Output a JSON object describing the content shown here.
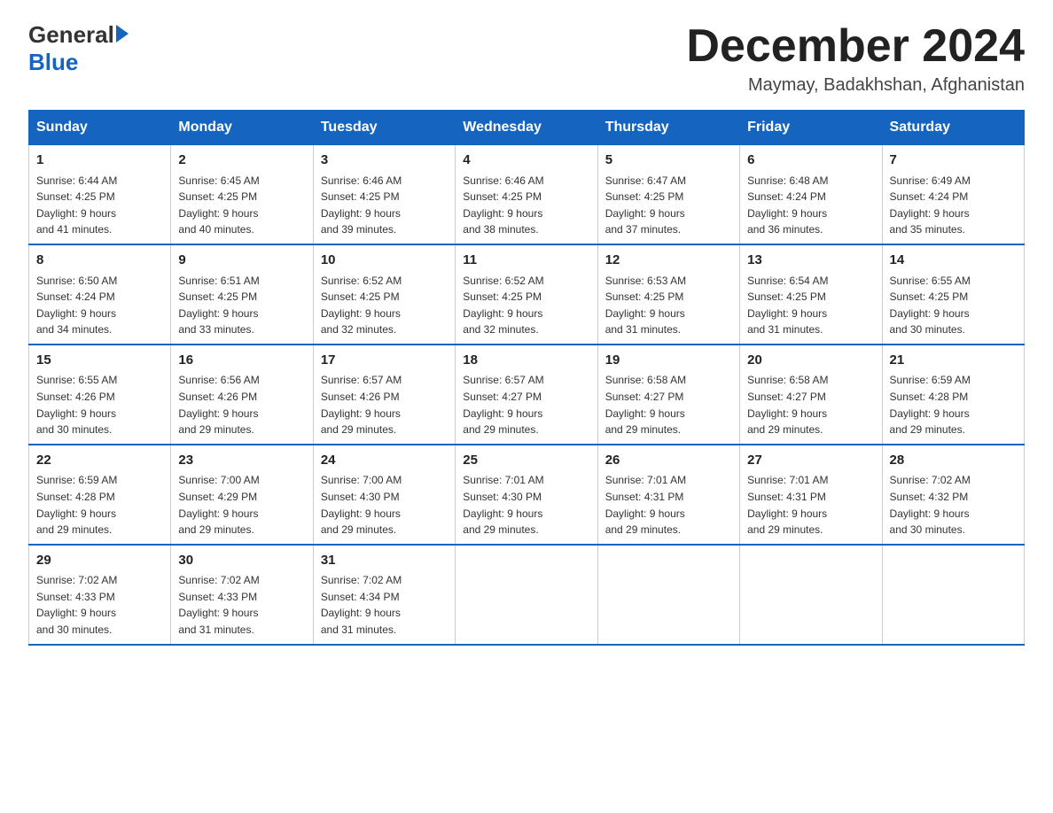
{
  "header": {
    "logo_general": "General",
    "logo_blue": "Blue",
    "month_title": "December 2024",
    "location": "Maymay, Badakhshan, Afghanistan"
  },
  "days_of_week": [
    "Sunday",
    "Monday",
    "Tuesday",
    "Wednesday",
    "Thursday",
    "Friday",
    "Saturday"
  ],
  "weeks": [
    [
      {
        "day": "1",
        "sunrise": "6:44 AM",
        "sunset": "4:25 PM",
        "daylight": "9 hours and 41 minutes."
      },
      {
        "day": "2",
        "sunrise": "6:45 AM",
        "sunset": "4:25 PM",
        "daylight": "9 hours and 40 minutes."
      },
      {
        "day": "3",
        "sunrise": "6:46 AM",
        "sunset": "4:25 PM",
        "daylight": "9 hours and 39 minutes."
      },
      {
        "day": "4",
        "sunrise": "6:46 AM",
        "sunset": "4:25 PM",
        "daylight": "9 hours and 38 minutes."
      },
      {
        "day": "5",
        "sunrise": "6:47 AM",
        "sunset": "4:25 PM",
        "daylight": "9 hours and 37 minutes."
      },
      {
        "day": "6",
        "sunrise": "6:48 AM",
        "sunset": "4:24 PM",
        "daylight": "9 hours and 36 minutes."
      },
      {
        "day": "7",
        "sunrise": "6:49 AM",
        "sunset": "4:24 PM",
        "daylight": "9 hours and 35 minutes."
      }
    ],
    [
      {
        "day": "8",
        "sunrise": "6:50 AM",
        "sunset": "4:24 PM",
        "daylight": "9 hours and 34 minutes."
      },
      {
        "day": "9",
        "sunrise": "6:51 AM",
        "sunset": "4:25 PM",
        "daylight": "9 hours and 33 minutes."
      },
      {
        "day": "10",
        "sunrise": "6:52 AM",
        "sunset": "4:25 PM",
        "daylight": "9 hours and 32 minutes."
      },
      {
        "day": "11",
        "sunrise": "6:52 AM",
        "sunset": "4:25 PM",
        "daylight": "9 hours and 32 minutes."
      },
      {
        "day": "12",
        "sunrise": "6:53 AM",
        "sunset": "4:25 PM",
        "daylight": "9 hours and 31 minutes."
      },
      {
        "day": "13",
        "sunrise": "6:54 AM",
        "sunset": "4:25 PM",
        "daylight": "9 hours and 31 minutes."
      },
      {
        "day": "14",
        "sunrise": "6:55 AM",
        "sunset": "4:25 PM",
        "daylight": "9 hours and 30 minutes."
      }
    ],
    [
      {
        "day": "15",
        "sunrise": "6:55 AM",
        "sunset": "4:26 PM",
        "daylight": "9 hours and 30 minutes."
      },
      {
        "day": "16",
        "sunrise": "6:56 AM",
        "sunset": "4:26 PM",
        "daylight": "9 hours and 29 minutes."
      },
      {
        "day": "17",
        "sunrise": "6:57 AM",
        "sunset": "4:26 PM",
        "daylight": "9 hours and 29 minutes."
      },
      {
        "day": "18",
        "sunrise": "6:57 AM",
        "sunset": "4:27 PM",
        "daylight": "9 hours and 29 minutes."
      },
      {
        "day": "19",
        "sunrise": "6:58 AM",
        "sunset": "4:27 PM",
        "daylight": "9 hours and 29 minutes."
      },
      {
        "day": "20",
        "sunrise": "6:58 AM",
        "sunset": "4:27 PM",
        "daylight": "9 hours and 29 minutes."
      },
      {
        "day": "21",
        "sunrise": "6:59 AM",
        "sunset": "4:28 PM",
        "daylight": "9 hours and 29 minutes."
      }
    ],
    [
      {
        "day": "22",
        "sunrise": "6:59 AM",
        "sunset": "4:28 PM",
        "daylight": "9 hours and 29 minutes."
      },
      {
        "day": "23",
        "sunrise": "7:00 AM",
        "sunset": "4:29 PM",
        "daylight": "9 hours and 29 minutes."
      },
      {
        "day": "24",
        "sunrise": "7:00 AM",
        "sunset": "4:30 PM",
        "daylight": "9 hours and 29 minutes."
      },
      {
        "day": "25",
        "sunrise": "7:01 AM",
        "sunset": "4:30 PM",
        "daylight": "9 hours and 29 minutes."
      },
      {
        "day": "26",
        "sunrise": "7:01 AM",
        "sunset": "4:31 PM",
        "daylight": "9 hours and 29 minutes."
      },
      {
        "day": "27",
        "sunrise": "7:01 AM",
        "sunset": "4:31 PM",
        "daylight": "9 hours and 29 minutes."
      },
      {
        "day": "28",
        "sunrise": "7:02 AM",
        "sunset": "4:32 PM",
        "daylight": "9 hours and 30 minutes."
      }
    ],
    [
      {
        "day": "29",
        "sunrise": "7:02 AM",
        "sunset": "4:33 PM",
        "daylight": "9 hours and 30 minutes."
      },
      {
        "day": "30",
        "sunrise": "7:02 AM",
        "sunset": "4:33 PM",
        "daylight": "9 hours and 31 minutes."
      },
      {
        "day": "31",
        "sunrise": "7:02 AM",
        "sunset": "4:34 PM",
        "daylight": "9 hours and 31 minutes."
      },
      null,
      null,
      null,
      null
    ]
  ],
  "labels": {
    "sunrise": "Sunrise:",
    "sunset": "Sunset:",
    "daylight": "Daylight:"
  }
}
